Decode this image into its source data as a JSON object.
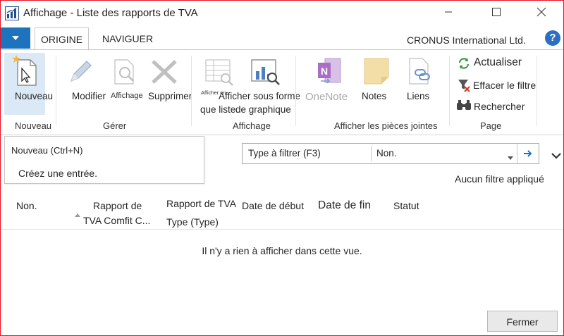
{
  "window": {
    "title": "Affichage - Liste des rapports de TVA"
  },
  "ribbon_tabs": [
    {
      "label": "ORIGINE"
    },
    {
      "label": "NAVIGUER"
    }
  ],
  "company": "CRONUS International Ltd.",
  "help": "?",
  "ribbon": {
    "nouveau": "Nouveau",
    "modifier": "Modifier",
    "affichage": "Affichage",
    "supprimer": "Supprimer",
    "afficher_liste_small": "Afficher en",
    "afficher_liste": "que liste",
    "afficher_graph_1": "Afficher sous forme",
    "afficher_graph_2": "de graphique",
    "onenote": "OneNote",
    "notes": "Notes",
    "liens": "Liens",
    "actualiser": "Actualiser",
    "effacer_filtre": "Effacer le filtre",
    "rechercher": "Rechercher",
    "groups": {
      "nouveau": "Nouveau",
      "gerer": "Gérer",
      "affichage": "Affichage",
      "pieces_jointes": "Afficher les pièces jointes",
      "page": "Page"
    }
  },
  "tooltip": {
    "title": "Nouveau (Ctrl+N)",
    "description": "Créez une entrée."
  },
  "filter": {
    "type_label": "Type à filtrer (F3)",
    "field": "Non."
  },
  "filter_status": "Aucun filtre appliqué",
  "columns": {
    "no": "Non.",
    "rapport_1": "Rapport de",
    "rapport_2": "TVA Comfit C...",
    "type_1": "Rapport de TVA",
    "type_2": "Type (Type)",
    "date_debut": "Date de début",
    "date_fin": "Date de fin",
    "statut": "Statut"
  },
  "empty_message": "Il n'y a rien à afficher dans cette vue.",
  "close_button": "Fermer",
  "colors": {
    "accent": "#1e73be",
    "frame": "#e81123",
    "onenote": "#a86fc4",
    "notes": "#f0d9a0"
  }
}
